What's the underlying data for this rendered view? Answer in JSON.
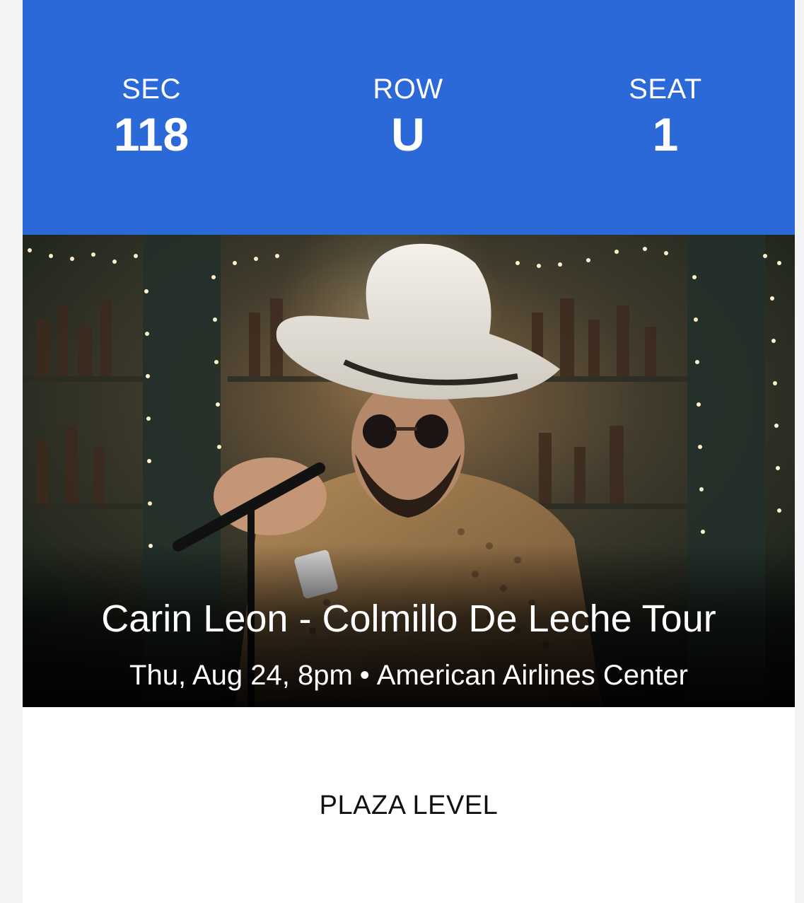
{
  "seat_info": {
    "section": {
      "label": "SEC",
      "value": "118"
    },
    "row": {
      "label": "ROW",
      "value": "U"
    },
    "seat": {
      "label": "SEAT",
      "value": "1"
    }
  },
  "event": {
    "title": "Carin Leon - Colmillo De Leche Tour",
    "date_time": "Thu, Aug 24, 8pm",
    "separator": "•",
    "venue": "American Airlines Center"
  },
  "level": "PLAZA LEVEL",
  "colors": {
    "header_blue": "#2b68d8",
    "card_background": "#ffffff",
    "text_on_blue": "#ffffff",
    "level_text": "#111111"
  }
}
